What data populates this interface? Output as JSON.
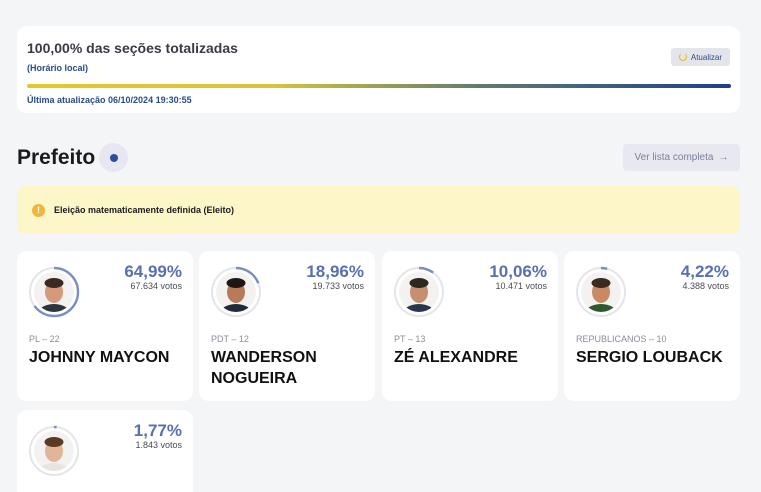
{
  "status": {
    "title": "100,00% das seções totalizadas",
    "local_time": "(Horário local)",
    "refresh_label": "Atualizar",
    "last_update": "Última atualização 06/10/2024 19:30:55",
    "progress_percent": 100
  },
  "section": {
    "title": "Prefeito",
    "full_list_label": "Ver lista completa",
    "arrow": "→"
  },
  "notice": {
    "icon": "!",
    "text": "Eleição matematicamente definida (Eleito)"
  },
  "candidates": [
    {
      "percent": "64,99%",
      "votes": "67.634 votos",
      "party": "PL – 22",
      "name": "JOHNNY MAYCON",
      "share": 0.6499,
      "skin": "#d49a7a",
      "hair": "#3a2a22",
      "shirt": "#2c3440"
    },
    {
      "percent": "18,96%",
      "votes": "19.733 votos",
      "party": "PDT – 12",
      "name": "WANDERSON NOGUEIRA",
      "share": 0.1896,
      "skin": "#b77a5a",
      "hair": "#1d1815",
      "shirt": "#1f2a3a"
    },
    {
      "percent": "10,06%",
      "votes": "10.471 votos",
      "party": "PT – 13",
      "name": "ZÉ ALEXANDRE",
      "share": 0.1006,
      "skin": "#c69070",
      "hair": "#2d2621",
      "shirt": "#2a3650"
    },
    {
      "percent": "4,22%",
      "votes": "4.388 votos",
      "party": "REPUBLICANOS – 10",
      "name": "SERGIO LOUBACK",
      "share": 0.0422,
      "skin": "#c98a63",
      "hair": "#3a2a20",
      "shirt": "#2d5a2d"
    },
    {
      "percent": "1,77%",
      "votes": "1.843 votos",
      "party": "",
      "name": "",
      "share": 0.0177,
      "skin": "#e2b49a",
      "hair": "#5a3a25",
      "shirt": "#e8e4e0"
    }
  ]
}
